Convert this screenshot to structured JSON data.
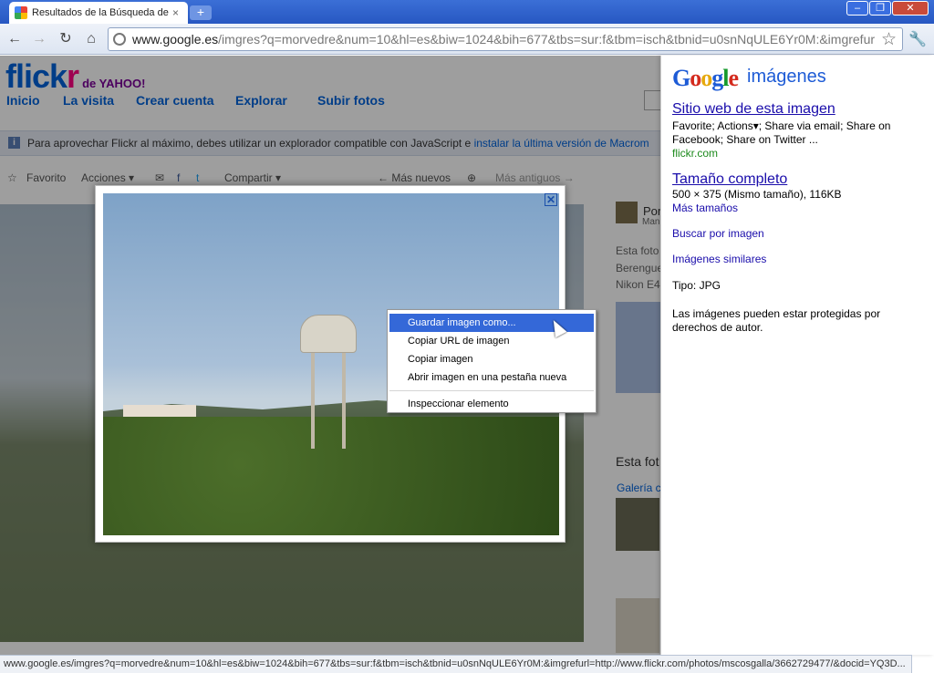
{
  "browser": {
    "tab_title": "Resultados de la Búsqueda de",
    "tab_close": "×",
    "new_tab": "+",
    "url_host": "www.google.es",
    "url_path": "/imgres?q=morvedre&num=10&hl=es&biw=1024&bih=677&tbs=sur:f&tbm=isch&tbnid=u0snNqULE6Yr0M:&imgrefurl",
    "status_url": "www.google.es/imgres?q=morvedre&num=10&hl=es&biw=1024&bih=677&tbs=sur:f&tbm=isch&tbnid=u0snNqULE6Yr0M:&imgrefurl=http://www.flickr.com/photos/mscosgalla/3662729477/&docid=YQ3D..."
  },
  "flickr": {
    "logo_main": "flick",
    "logo_r": "r",
    "logo_sub": "de YAHOO!",
    "nav": [
      "Inicio",
      "La visita",
      "Crear cuenta",
      "Explorar",
      "Subir fotos"
    ],
    "notice": "Para aprovechar Flickr al máximo, debes utilizar un explorador compatible con JavaScript e",
    "notice_link": "instalar la última versión de Macrom",
    "actions": {
      "favorito": "Favorito",
      "acciones": "Acciones ▾",
      "compartir": "Compartir ▾",
      "mas_nuevos": "← Más nuevos",
      "mas_antiguos": "Más antiguos →"
    },
    "side": {
      "por": "Por",
      "man": "Man",
      "esta_foto": "Esta foto",
      "bereng": "Berengue",
      "nikon": "Nikon E4",
      "esta_fot2": "Esta fot",
      "galeria": "Galería c"
    }
  },
  "context_menu": {
    "items": [
      "Guardar imagen como...",
      "Copiar URL de imagen",
      "Copiar imagen",
      "Abrir imagen en una pestaña nueva"
    ],
    "inspect": "Inspeccionar elemento"
  },
  "google_panel": {
    "logo_parts": [
      "G",
      "o",
      "o",
      "g",
      "l",
      "e"
    ],
    "imagenes": "imágenes",
    "site_link": "Sitio web de esta imagen",
    "site_desc": "Favorite; Actions▾; Share via email; Share on Facebook; Share on Twitter ...",
    "site_domain": "flickr.com",
    "full_size": "Tamaño completo",
    "size_info": "500 × 375 (Mismo tamaño), 116KB",
    "more_sizes": "Más tamaños",
    "search_by_image": "Buscar por imagen",
    "similar": "Imágenes similares",
    "type_label": "Tipo:",
    "type_value": "JPG",
    "copyright": "Las imágenes pueden estar protegidas por derechos de autor."
  },
  "colors": {
    "titlebar": "#2757c2",
    "flickr_blue": "#0063dc",
    "flickr_pink": "#ff0084",
    "menu_highlight": "#3468d8",
    "google_link": "#1a0dab",
    "green_url": "#1c8a1c"
  }
}
